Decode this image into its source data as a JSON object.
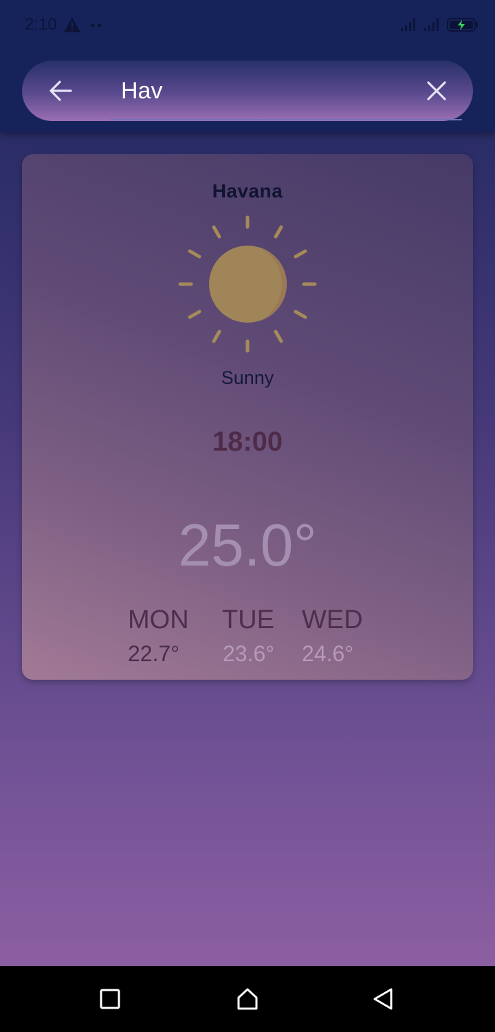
{
  "status_bar": {
    "time": "2:10",
    "battery_color": "#3ad65a"
  },
  "search": {
    "value": "Hav",
    "back_icon": "arrow-left-icon",
    "clear_icon": "close-icon"
  },
  "weather": {
    "city": "Havana",
    "condition": "Sunny",
    "icon": "sun-icon",
    "time": "18:00",
    "temperature": "25.0°",
    "forecast": [
      {
        "day": "MON",
        "temp": "22.7°"
      },
      {
        "day": "TUE",
        "temp": "23.6°"
      },
      {
        "day": "WED",
        "temp": "24.6°"
      }
    ]
  },
  "colors": {
    "appbar": "#15235a",
    "sun": "#a08558",
    "sun_rays": "#a58a5a"
  }
}
